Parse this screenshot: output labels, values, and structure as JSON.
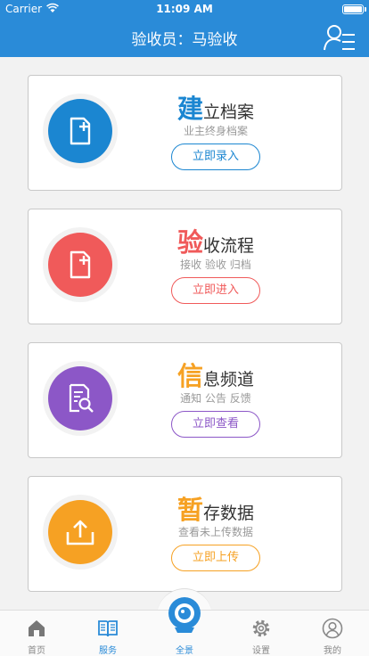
{
  "status_bar": {
    "carrier": "Carrier",
    "time": "11:09 AM"
  },
  "nav": {
    "title": "验收员：马验收"
  },
  "colors": {
    "nav_blue": "#2a8bd8",
    "blue": "#1b86d1",
    "red": "#f05a5a",
    "purple": "#8c57c7",
    "orange": "#f6a123"
  },
  "cards": [
    {
      "title_big": "建",
      "title_rest": "立档案",
      "subtitle": "业主终身档案",
      "button": "立即录入",
      "icon": "file-plus-icon"
    },
    {
      "title_big": "验",
      "title_rest": "收流程",
      "subtitle": "接收 验收 归档",
      "button": "立即进入",
      "icon": "file-plus-icon"
    },
    {
      "title_big": "信",
      "title_rest": "息频道",
      "subtitle": "通知 公告 反馈",
      "button": "立即查看",
      "icon": "document-search-icon"
    },
    {
      "title_big": "暂",
      "title_rest": "存数据",
      "subtitle": "查看未上传数据",
      "button": "立即上传",
      "icon": "upload-icon"
    }
  ],
  "tabs": [
    {
      "label": "首页",
      "icon": "home-icon",
      "active": false
    },
    {
      "label": "服务",
      "icon": "book-icon",
      "active": true
    },
    {
      "label": "全景",
      "icon": "camera-icon",
      "active": false
    },
    {
      "label": "设置",
      "icon": "gear-icon",
      "active": false
    },
    {
      "label": "我的",
      "icon": "user-icon",
      "active": false
    }
  ]
}
